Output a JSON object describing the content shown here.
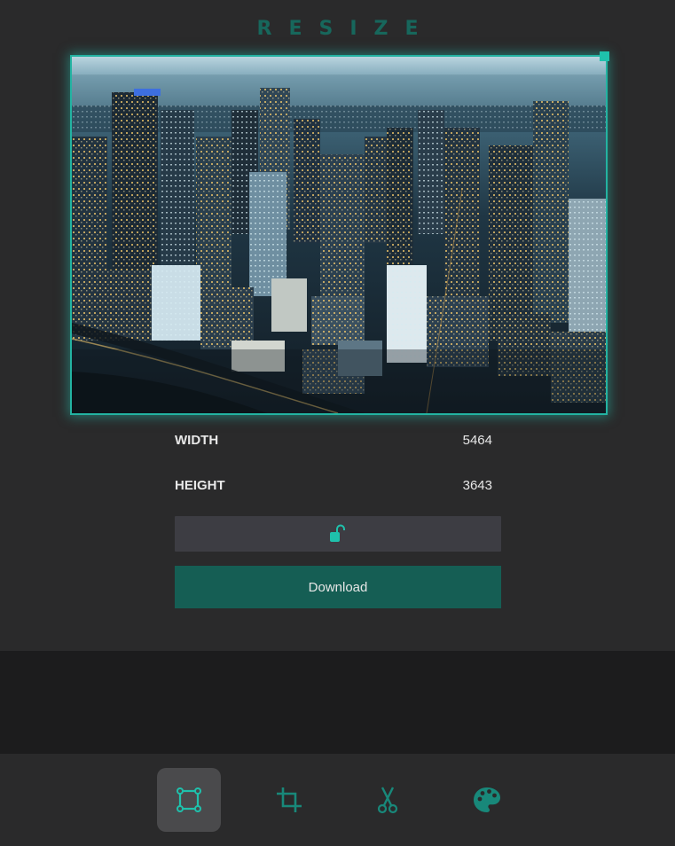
{
  "header": {
    "title": "RESIZE"
  },
  "image": {
    "subject": "aerial city skyline at dusk",
    "frame_color": "#23b3a2"
  },
  "dimensions": {
    "width_label": "WIDTH",
    "width_value": "5464",
    "height_label": "HEIGHT",
    "height_value": "3643"
  },
  "lock": {
    "icon": "unlock-icon",
    "state": "unlocked"
  },
  "actions": {
    "download_label": "Download"
  },
  "toolbar": {
    "tools": [
      {
        "id": "resize",
        "icon": "resize-icon",
        "active": true
      },
      {
        "id": "crop",
        "icon": "crop-icon",
        "active": false
      },
      {
        "id": "cut",
        "icon": "scissors-icon",
        "active": false
      },
      {
        "id": "filters",
        "icon": "palette-icon",
        "active": false
      }
    ]
  },
  "colors": {
    "accent": "#1fc1ac",
    "accent_dark": "#155e54",
    "panel_bg": "#2a2a2b",
    "page_bg": "#1c1c1d"
  }
}
